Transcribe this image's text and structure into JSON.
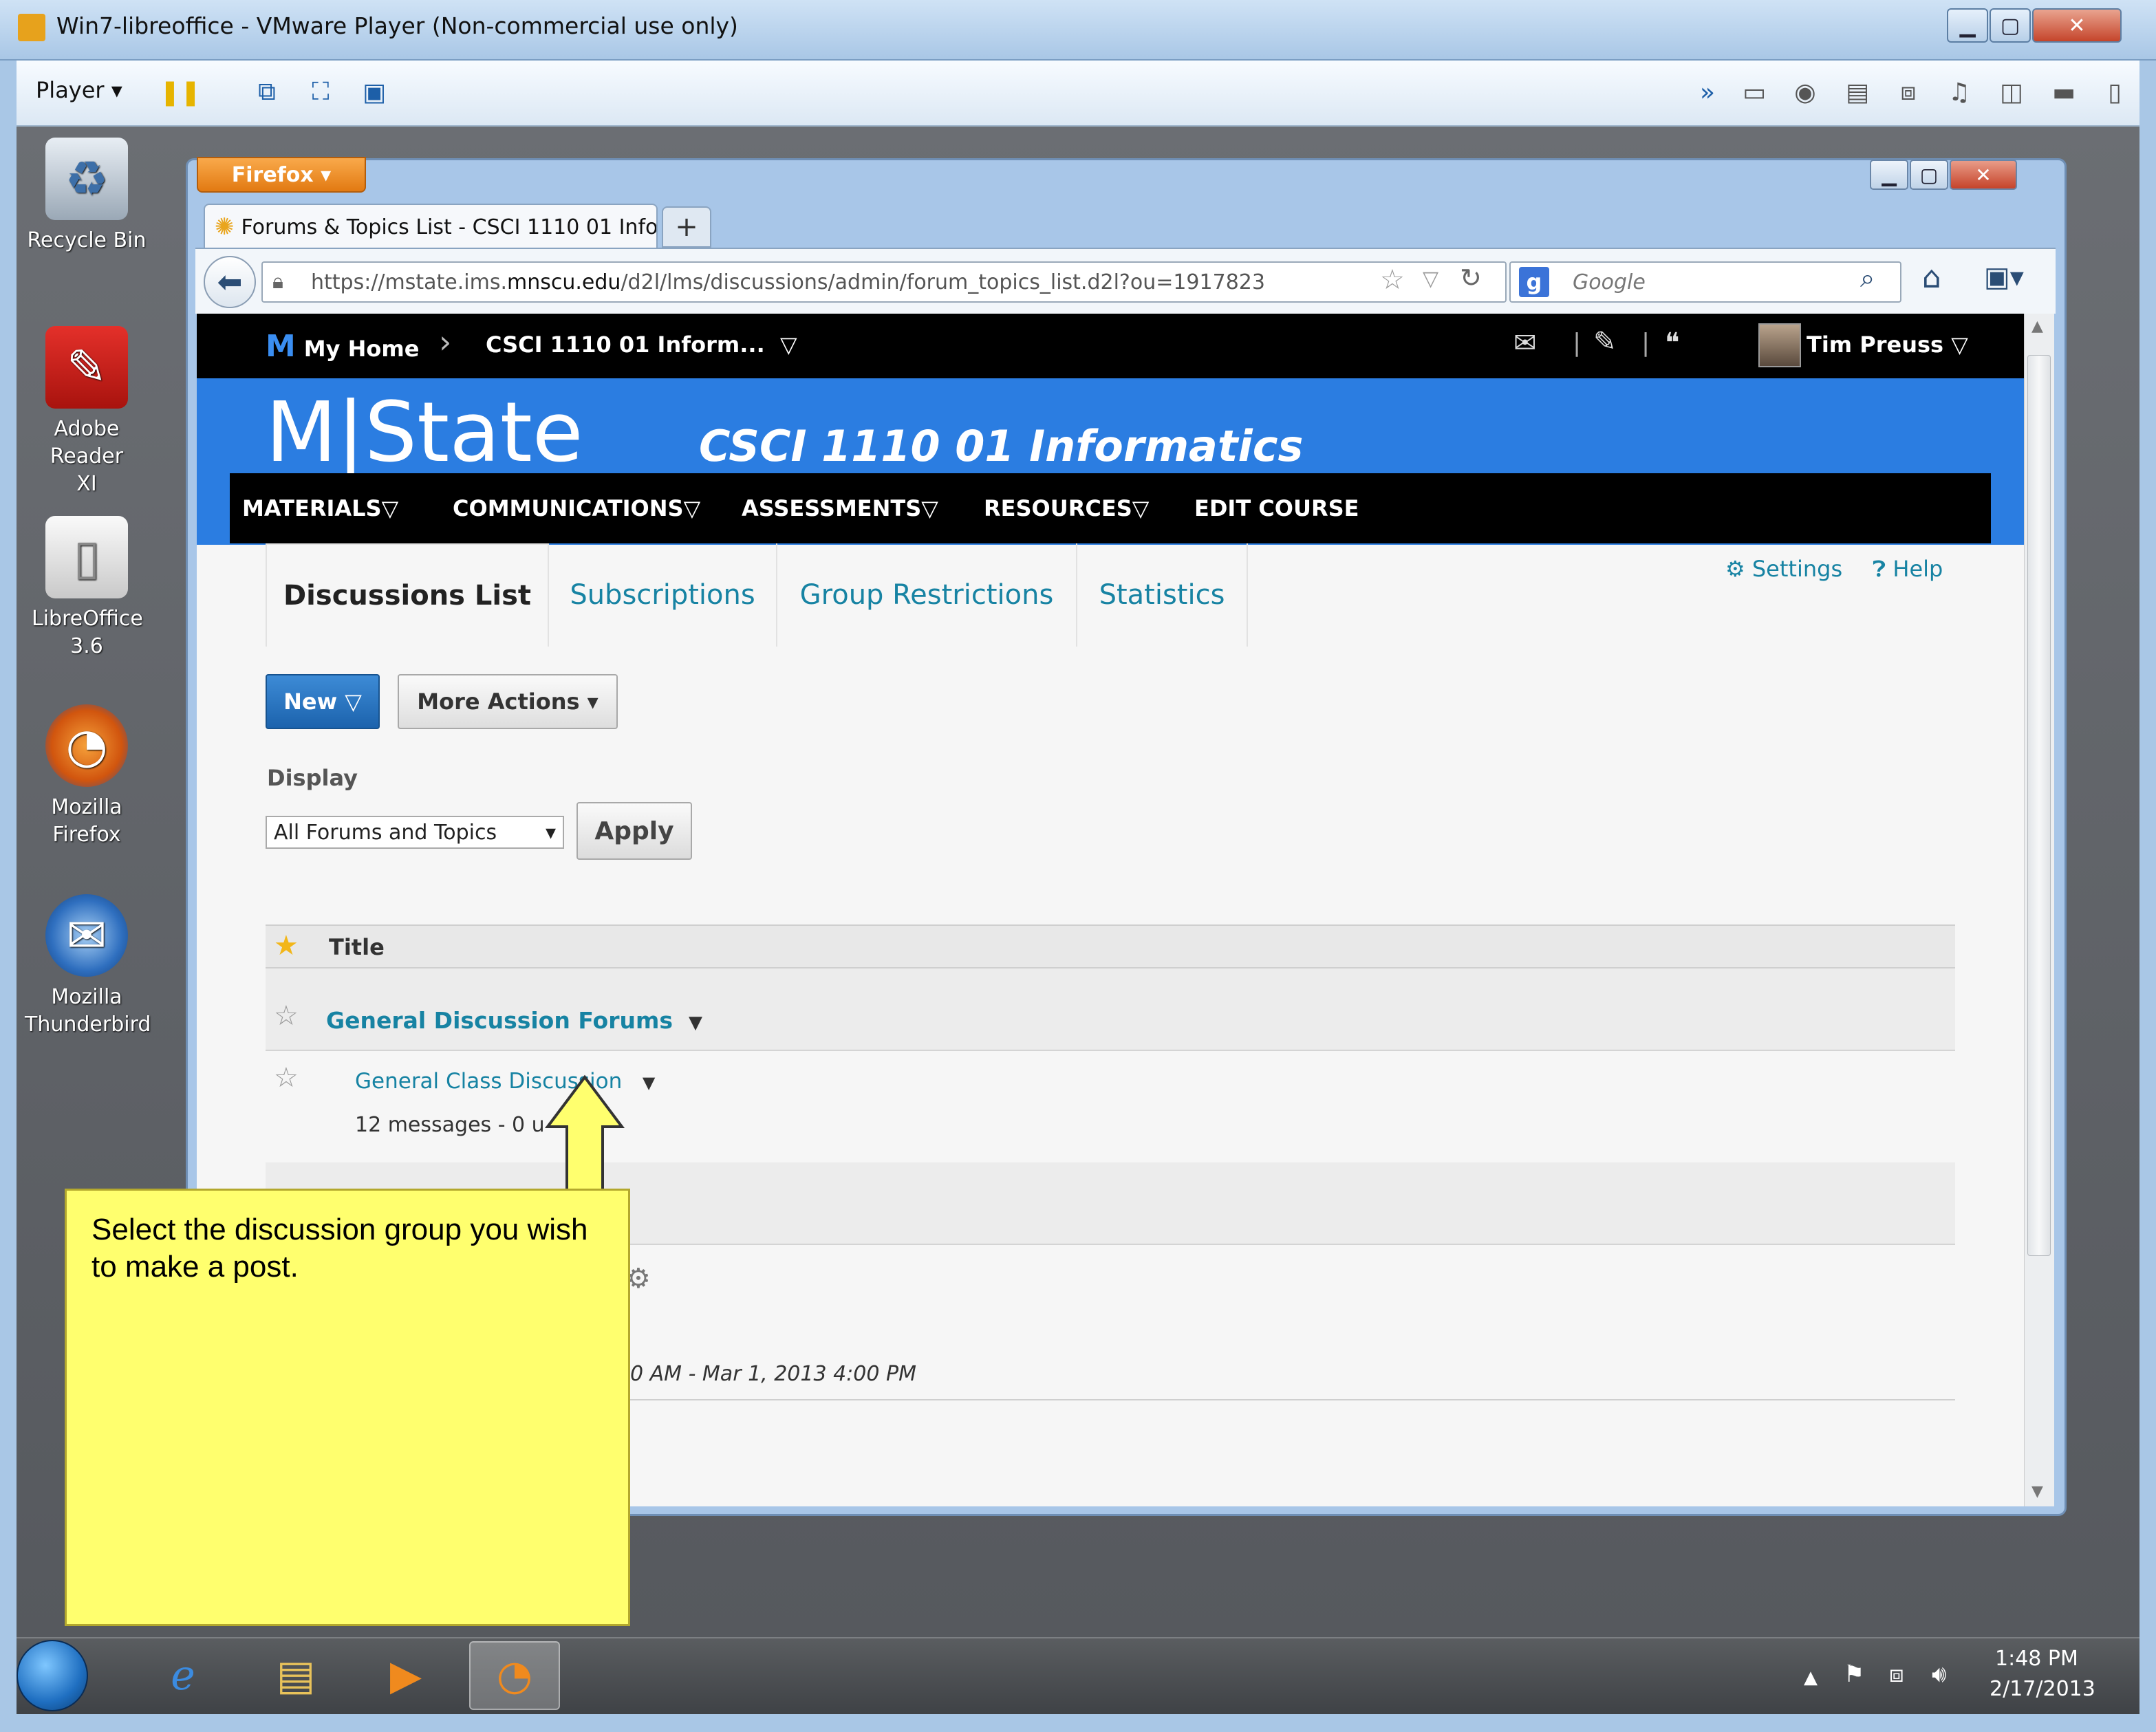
{
  "vm": {
    "title": "Win7-libreoffice - VMware Player (Non-commercial use only)",
    "player_menu": "Player ▾",
    "minimize": "▁",
    "maximize": "▢",
    "close": "✕"
  },
  "desktop_icons": [
    {
      "label": "Recycle Bin"
    },
    {
      "label": "Adobe Reader XI"
    },
    {
      "label": "LibreOffice 3.6"
    },
    {
      "label": "Mozilla Firefox"
    },
    {
      "label": "Mozilla Thunderbird"
    }
  ],
  "firefox": {
    "button": "Firefox ▾",
    "tab_title": "Forums & Topics List - CSCI 1110 01 Info...",
    "new_tab": "+",
    "url_prefix": "https://mstate.ims.",
    "url_host": "mnscu.edu",
    "url_path": "/d2l/lms/discussions/admin/forum_topics_list.d2l?ou=1917823",
    "search_placeholder": "Google",
    "search_engine": "g"
  },
  "lms": {
    "my_home": "My Home",
    "course_crumb": "CSCI 1110 01 Inform...",
    "user_name": "Tim Preuss",
    "logo": "M|State",
    "course_title": "CSCI 1110 01 Informatics",
    "menu": [
      "MATERIALS",
      "COMMUNICATIONS",
      "ASSESSMENTS",
      "RESOURCES",
      "EDIT COURSE"
    ],
    "tabs": [
      "Discussions List",
      "Subscriptions",
      "Group Restrictions",
      "Statistics"
    ],
    "settings": "Settings",
    "help": "Help",
    "new_button": "New",
    "more_actions": "More Actions",
    "display_label": "Display",
    "display_value": "All Forums and Topics",
    "apply": "Apply",
    "title_header": "Title",
    "forum_name": "General Discussion Forums",
    "topic_name": "General Class Discussion",
    "topic_meta": "12 messages - 0 u",
    "dates_text": "0 AM - Mar 1, 2013 4:00 PM"
  },
  "callout": {
    "text": "Select the discussion group you wish to make a post."
  },
  "taskbar": {
    "time": "1:48 PM",
    "date": "2/17/2013"
  },
  "colors": {
    "banner_blue": "#2b7de1",
    "link_teal": "#1783a3",
    "callout_yellow": "#ffff6e"
  }
}
